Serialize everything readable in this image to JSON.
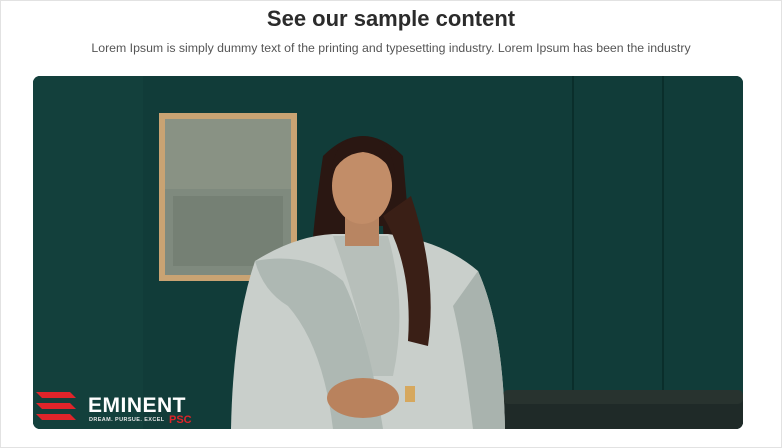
{
  "section": {
    "title": "See our sample content",
    "subtitle": "Lorem Ipsum is simply dummy text of the printing and typesetting industry. Lorem Ipsum has been the industry"
  },
  "video": {
    "brand": {
      "name": "EMINENT",
      "tagline": "DREAM. PURSUE. EXCEL",
      "suffix": "PSC"
    }
  },
  "colors": {
    "background": "#ffffff",
    "title": "#2b2b2b",
    "subtitle": "#555555",
    "video_wall": "#0f3b37",
    "brand_red": "#e0242a"
  }
}
